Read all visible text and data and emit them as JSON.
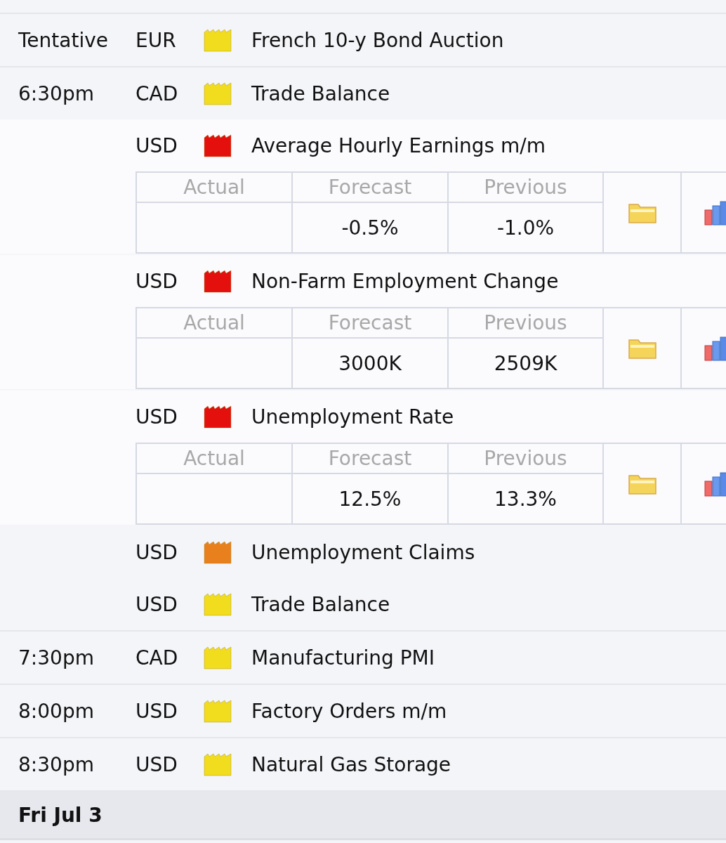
{
  "groups": [
    {
      "time": "Tentative",
      "events": [
        {
          "currency": "EUR",
          "color": "#f2dc1e",
          "event": "French 10-y Bond Auction"
        }
      ]
    },
    {
      "time": "6:30pm",
      "events": [
        {
          "currency": "CAD",
          "color": "#f2dc1e",
          "event": "Trade Balance"
        },
        {
          "currency": "USD",
          "color": "#e3100e",
          "event": "Average Hourly Earnings m/m",
          "details": {
            "headers": [
              "Actual",
              "Forecast",
              "Previous"
            ],
            "forecast": "-0.5%",
            "previous": "-1.0%"
          }
        },
        {
          "currency": "USD",
          "color": "#e3100e",
          "event": "Non-Farm Employment Change",
          "details": {
            "headers": [
              "Actual",
              "Forecast",
              "Previous"
            ],
            "forecast": "3000K",
            "previous": "2509K"
          }
        },
        {
          "currency": "USD",
          "color": "#e3100e",
          "event": "Unemployment Rate",
          "details": {
            "headers": [
              "Actual",
              "Forecast",
              "Previous"
            ],
            "forecast": "12.5%",
            "previous": "13.3%"
          }
        },
        {
          "currency": "USD",
          "color": "#e8801e",
          "event": "Unemployment Claims"
        },
        {
          "currency": "USD",
          "color": "#f2dc1e",
          "event": "Trade Balance"
        }
      ]
    },
    {
      "time": "7:30pm",
      "events": [
        {
          "currency": "CAD",
          "color": "#f2dc1e",
          "event": "Manufacturing PMI"
        }
      ]
    },
    {
      "time": "8:00pm",
      "events": [
        {
          "currency": "USD",
          "color": "#f2dc1e",
          "event": "Factory Orders m/m"
        }
      ]
    },
    {
      "time": "8:30pm",
      "events": [
        {
          "currency": "USD",
          "color": "#f2dc1e",
          "event": "Natural Gas Storage"
        }
      ]
    }
  ],
  "day_header": "Fri Jul 3"
}
